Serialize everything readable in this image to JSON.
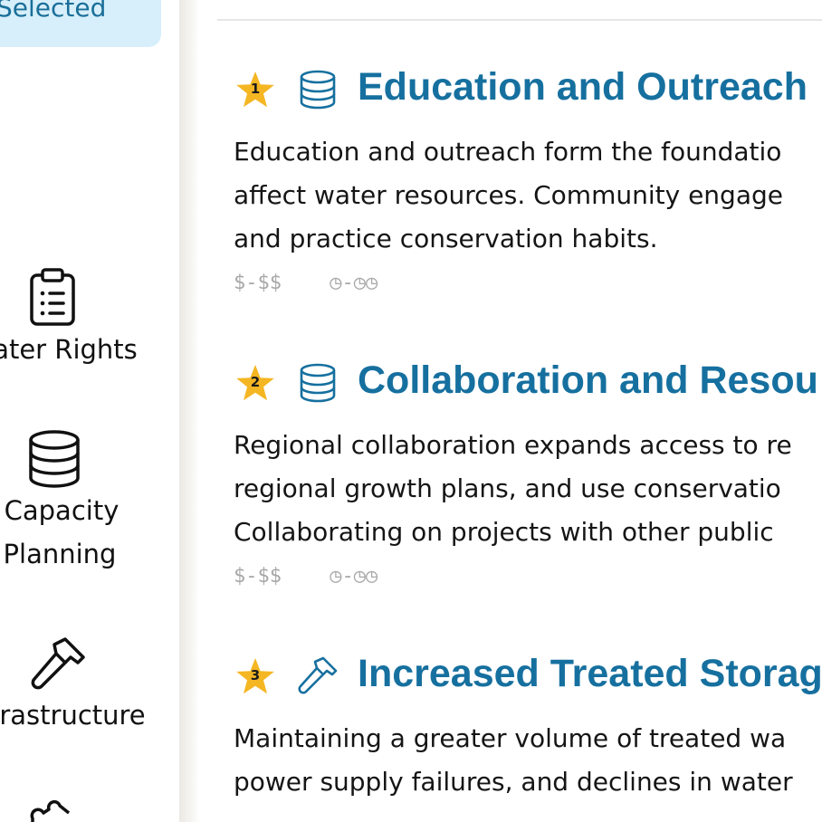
{
  "sidebar": {
    "selected_label": "Selected",
    "items": [
      {
        "label": "ater Rights",
        "icon": "clipboard-icon"
      },
      {
        "label_line1": "Capacity",
        "label_line2": "Planning",
        "icon": "database-icon"
      },
      {
        "label": "rastructure",
        "icon": "hammer-icon"
      }
    ]
  },
  "cards": [
    {
      "rank": "1",
      "icon": "database-icon",
      "title": "Education and Outreach",
      "lines": [
        "Education and outreach form the foundatio",
        "affect water resources. Community engage",
        "and practice conservation habits."
      ],
      "cost": "$-$$",
      "time": "◷-◷◷"
    },
    {
      "rank": "2",
      "icon": "database-icon",
      "title": "Collaboration and Resou",
      "lines": [
        "Regional collaboration expands access to re",
        "regional growth plans, and use conservatio",
        "Collaborating on projects with other public"
      ],
      "cost": "$-$$",
      "time": "◷-◷◷"
    },
    {
      "rank": "3",
      "icon": "hammer-icon",
      "title": "Increased Treated Storag",
      "lines": [
        "Maintaining a greater volume of treated wa",
        "power supply failures, and declines in water"
      ]
    }
  ],
  "colors": {
    "accent": "#16709f",
    "selected_bg": "#d7effa",
    "star": "#f5b623",
    "meta": "#a8a8a8"
  }
}
